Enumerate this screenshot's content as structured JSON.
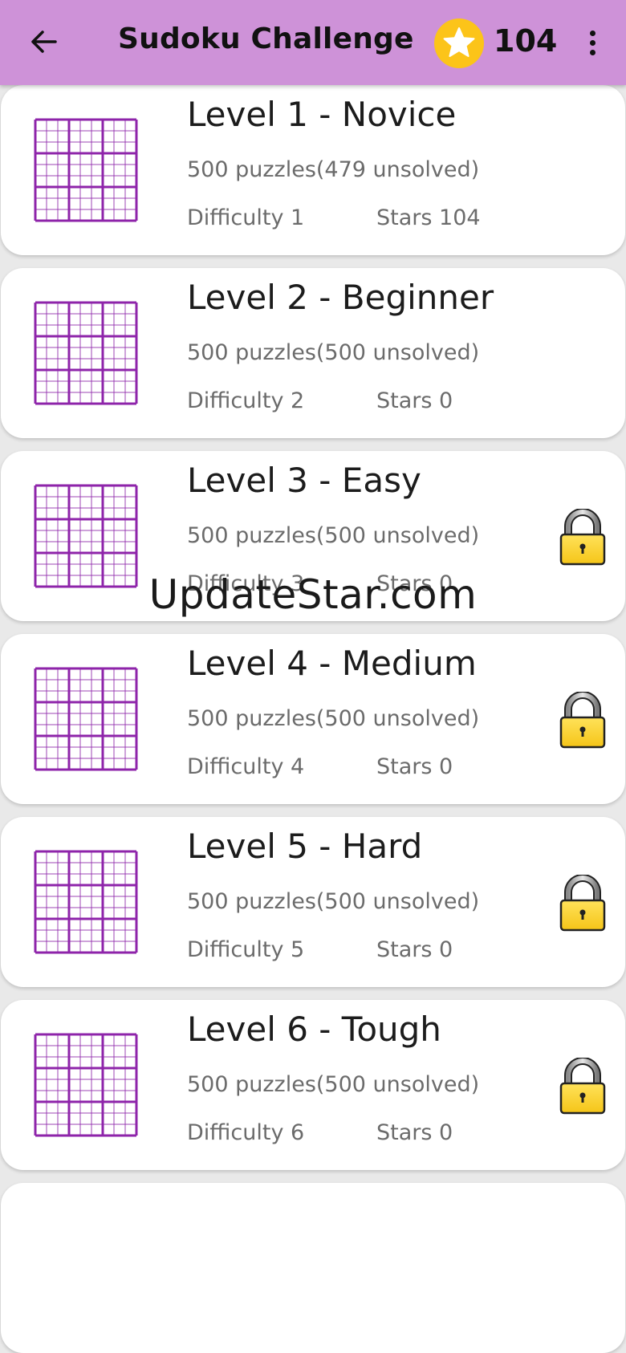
{
  "app_bar": {
    "title": "Sudoku Challenge",
    "coins": "104",
    "back_icon": "arrow-back-icon",
    "menu_icon": "more-vert-icon",
    "coin_icon": "star-coin-icon",
    "background_color": "#ce92d8"
  },
  "levels": [
    {
      "name": "Level 1 - Novice",
      "puzzles": "500 puzzles(479 unsolved)",
      "difficulty": "Difficulty  1",
      "stars": "Stars  104",
      "locked": false
    },
    {
      "name": "Level 2 - Beginner",
      "puzzles": "500 puzzles(500 unsolved)",
      "difficulty": "Difficulty  2",
      "stars": "Stars  0",
      "locked": false
    },
    {
      "name": "Level 3 - Easy",
      "puzzles": "500 puzzles(500 unsolved)",
      "difficulty": "Difficulty  3",
      "stars": "Stars  0",
      "locked": true
    },
    {
      "name": "Level 4 - Medium",
      "puzzles": "500 puzzles(500 unsolved)",
      "difficulty": "Difficulty  4",
      "stars": "Stars  0",
      "locked": true
    },
    {
      "name": "Level 5 - Hard",
      "puzzles": "500 puzzles(500 unsolved)",
      "difficulty": "Difficulty  5",
      "stars": "Stars  0",
      "locked": true
    },
    {
      "name": "Level 6 - Tough",
      "puzzles": "500 puzzles(500 unsolved)",
      "difficulty": "Difficulty  6",
      "stars": "Stars  0",
      "locked": true
    }
  ],
  "icons": {
    "grid": "sudoku-grid-icon",
    "lock": "padlock-icon"
  },
  "colors": {
    "grid_purple": "#8e24aa",
    "lock_gold": "#f5c518"
  },
  "watermark": "UpdateStar.com"
}
